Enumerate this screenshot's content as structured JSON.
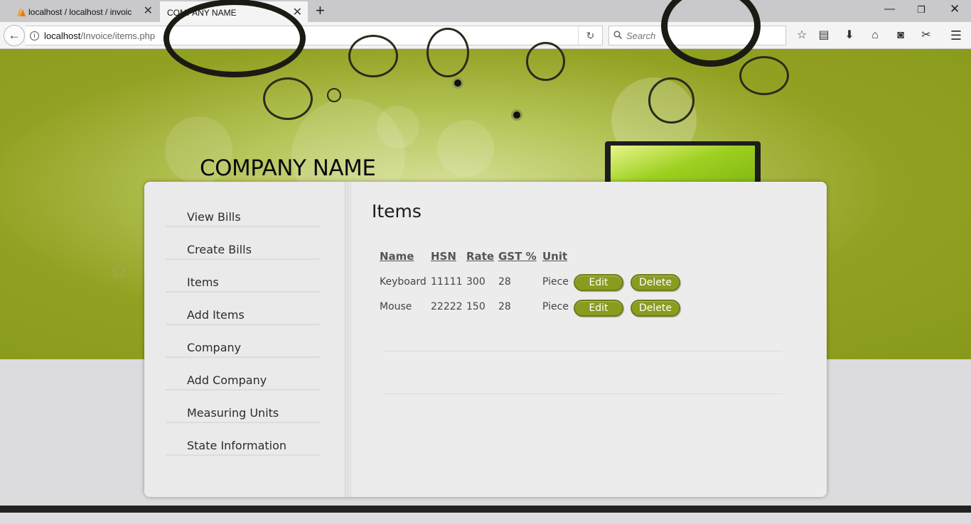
{
  "browser": {
    "tabs": [
      {
        "title": "localhost / localhost / invoic",
        "active": false
      },
      {
        "title": "COMPANY NAME",
        "active": true
      }
    ],
    "url_host": "localhost",
    "url_path": "/Invoice/items.php",
    "search_placeholder": "Search"
  },
  "site": {
    "company_name": "COMPANY NAME",
    "accent_color": "#8a9b1e"
  },
  "sidebar": {
    "items": [
      {
        "label": "View Bills"
      },
      {
        "label": "Create Bills"
      },
      {
        "label": "Items"
      },
      {
        "label": "Add Items"
      },
      {
        "label": "Company"
      },
      {
        "label": "Add Company"
      },
      {
        "label": "Measuring Units"
      },
      {
        "label": "State Information"
      }
    ]
  },
  "items_page": {
    "title": "Items",
    "columns": [
      "Name",
      "HSN",
      "Rate",
      "GST %",
      "Unit"
    ],
    "rows": [
      {
        "name": "Keyboard",
        "hsn": "11111",
        "rate": "300",
        "gst": "28",
        "unit": "Piece"
      },
      {
        "name": "Mouse",
        "hsn": "22222",
        "rate": "150",
        "gst": "28",
        "unit": "Piece"
      }
    ],
    "edit_label": "Edit",
    "delete_label": "Delete"
  }
}
